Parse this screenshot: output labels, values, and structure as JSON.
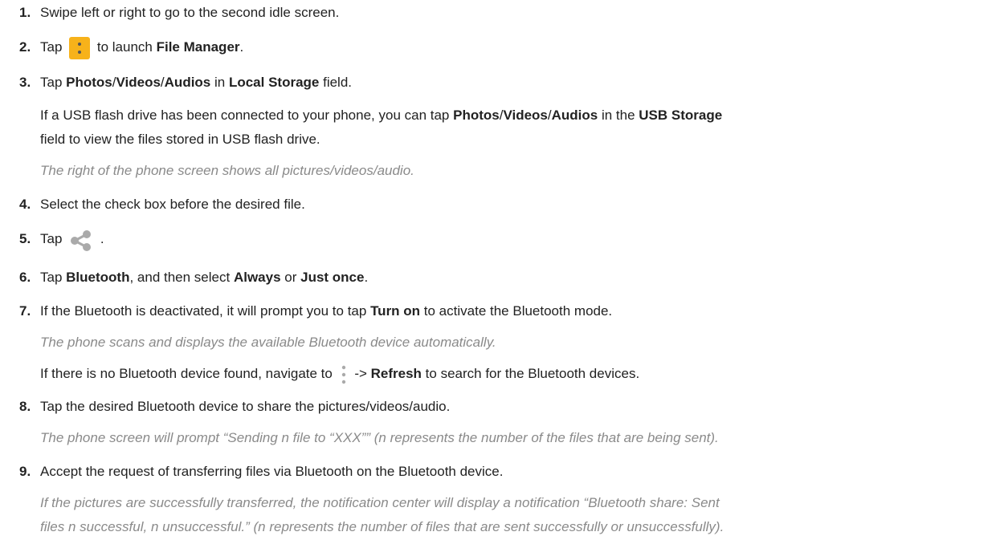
{
  "steps": [
    {
      "num": "1.",
      "parts": [
        {
          "t": "Swipe left or right to go to the second idle screen."
        }
      ]
    },
    {
      "num": "2.",
      "parts": [
        {
          "t": "Tap "
        },
        {
          "icon": "file-manager-icon"
        },
        {
          "t": " to launch "
        },
        {
          "b": "File Manager"
        },
        {
          "t": "."
        }
      ]
    },
    {
      "num": "3.",
      "parts": [
        {
          "t": "Tap "
        },
        {
          "b": "Photos"
        },
        {
          "t": "/"
        },
        {
          "b": "Videos"
        },
        {
          "t": "/"
        },
        {
          "b": "Audios"
        },
        {
          "t": " in "
        },
        {
          "b": "Local Storage"
        },
        {
          "t": " field."
        }
      ]
    },
    {
      "num": "4.",
      "parts": [
        {
          "t": "Select the check box before the desired file."
        }
      ]
    },
    {
      "num": "5.",
      "parts": [
        {
          "t": "Tap "
        },
        {
          "icon": "share-icon"
        },
        {
          "t": " ."
        }
      ]
    },
    {
      "num": "6.",
      "parts": [
        {
          "t": "Tap "
        },
        {
          "b": "Bluetooth"
        },
        {
          "t": ", and then select "
        },
        {
          "b": "Always"
        },
        {
          "t": " or "
        },
        {
          "b": "Just once"
        },
        {
          "t": "."
        }
      ]
    },
    {
      "num": "7.",
      "parts": [
        {
          "t": "If the Bluetooth is deactivated, it will prompt you to tap "
        },
        {
          "b": "Turn on"
        },
        {
          "t": " to activate the Bluetooth mode."
        }
      ]
    },
    {
      "num": "8.",
      "parts": [
        {
          "t": "Tap the desired Bluetooth device to share the pictures/videos/audio."
        }
      ]
    },
    {
      "num": "9.",
      "parts": [
        {
          "t": "Accept the request of transferring files via Bluetooth on the Bluetooth device."
        }
      ]
    }
  ],
  "sublines": {
    "s3a": [
      {
        "t": "If a USB flash drive has been connected to your phone, you can tap "
      },
      {
        "b": "Photos"
      },
      {
        "t": "/"
      },
      {
        "b": "Videos"
      },
      {
        "t": "/"
      },
      {
        "b": "Audios"
      },
      {
        "t": " in the "
      },
      {
        "b": "USB Storage"
      }
    ],
    "s3b": [
      {
        "t": "field to view the files stored in USB flash drive."
      }
    ],
    "s3note": [
      {
        "t": "The right of the phone screen shows all pictures/videos/audio."
      }
    ],
    "s7note": [
      {
        "t": "The phone scans and displays the available Bluetooth device automatically."
      }
    ],
    "s7b": [
      {
        "t": "If there is no Bluetooth device found, navigate to "
      },
      {
        "icon": "menu-dots-icon"
      },
      {
        "t": " -> "
      },
      {
        "b": "Refresh"
      },
      {
        "t": " to search for the Bluetooth devices."
      }
    ],
    "s8note": [
      {
        "t": "The phone screen will prompt “Sending n file to “XXX”” (n represents the number of the files that are being sent)."
      }
    ],
    "s9note_a": [
      {
        "t": "If the pictures are successfully transferred, the notification center will display a notification “Bluetooth share: Sent"
      }
    ],
    "s9note_b": [
      {
        "t": "files n successful, n unsuccessful.” (n represents the number of files that are sent successfully or unsuccessfully)."
      }
    ]
  },
  "colors": {
    "text": "#222222",
    "note": "#8a8a8a",
    "file_icon": "#f7b21a"
  }
}
